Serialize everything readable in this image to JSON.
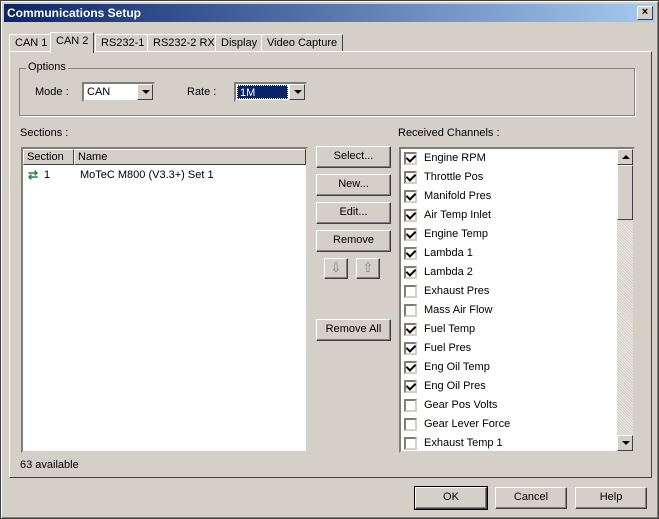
{
  "window": {
    "title": "Communications Setup",
    "close_glyph": "×"
  },
  "tabs": [
    {
      "label": "CAN 1"
    },
    {
      "label": "CAN 2"
    },
    {
      "label": "RS232-1"
    },
    {
      "label": "RS232-2 RX"
    },
    {
      "label": "Display"
    },
    {
      "label": "Video Capture"
    }
  ],
  "active_tab": "CAN 2",
  "options": {
    "legend": "Options",
    "mode_label": "Mode :",
    "mode_value": "CAN",
    "rate_label": "Rate :",
    "rate_value": "1M"
  },
  "sections": {
    "label": "Sections :",
    "columns": [
      "Section",
      "Name"
    ],
    "rows": [
      {
        "section": "1",
        "name": "MoTeC M800 (V3.3+) Set 1",
        "icon": "arrows-exchange-icon"
      }
    ],
    "available": "63 available"
  },
  "section_buttons": {
    "select": "Select...",
    "new": "New...",
    "edit": "Edit...",
    "remove": "Remove",
    "move_down": "⇩",
    "move_up": "⇧",
    "remove_all": "Remove All"
  },
  "received_channels": {
    "label": "Received Channels :",
    "items": [
      {
        "label": "Engine RPM",
        "checked": true
      },
      {
        "label": "Throttle Pos",
        "checked": true
      },
      {
        "label": "Manifold Pres",
        "checked": true
      },
      {
        "label": "Air Temp Inlet",
        "checked": true
      },
      {
        "label": "Engine Temp",
        "checked": true
      },
      {
        "label": "Lambda 1",
        "checked": true
      },
      {
        "label": "Lambda 2",
        "checked": true
      },
      {
        "label": "Exhaust Pres",
        "checked": false
      },
      {
        "label": "Mass Air Flow",
        "checked": false
      },
      {
        "label": "Fuel Temp",
        "checked": true
      },
      {
        "label": "Fuel Pres",
        "checked": true
      },
      {
        "label": "Eng Oil Temp",
        "checked": true
      },
      {
        "label": "Eng Oil Pres",
        "checked": true
      },
      {
        "label": "Gear Pos Volts",
        "checked": false
      },
      {
        "label": "Gear Lever Force",
        "checked": false
      },
      {
        "label": "Exhaust Temp 1",
        "checked": false
      }
    ]
  },
  "footer": {
    "ok": "OK",
    "cancel": "Cancel",
    "help": "Help"
  },
  "colors": {
    "face": "#d4d0c8",
    "title_start": "#0a246a",
    "title_end": "#a6caf0",
    "selection": "#0a246a"
  }
}
